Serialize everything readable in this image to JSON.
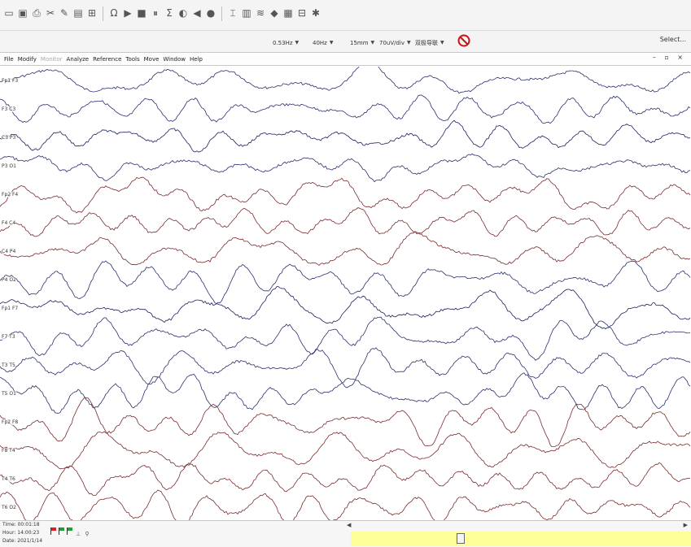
{
  "toolbar1": {
    "icons": [
      "folder-icon",
      "save-icon",
      "print-icon",
      "scissors-icon",
      "pen-icon",
      "notes-icon",
      "montage-icon",
      "ohm-icon",
      "play-icon",
      "stop-icon",
      "pause-icon",
      "sum-icon",
      "photo-icon",
      "back-icon",
      "record-icon",
      "cursor-icon",
      "histogram-icon",
      "filter-icon",
      "cube-icon",
      "map-icon",
      "grid-icon",
      "photic-icon"
    ]
  },
  "toolbar2": {
    "low_filter": "0.53Hz",
    "high_filter": "40Hz",
    "speed": "15mm",
    "sensitivity": "70uV/div",
    "montage": "双极导联",
    "select_label": "Select..."
  },
  "menu": {
    "items": [
      {
        "label": "File"
      },
      {
        "label": "Modify"
      },
      {
        "label": "Monitor",
        "disabled": true
      },
      {
        "label": "Analyze"
      },
      {
        "label": "Reference"
      },
      {
        "label": "Tools"
      },
      {
        "label": "Move"
      },
      {
        "label": "Window"
      },
      {
        "label": "Help"
      }
    ]
  },
  "channels": [
    {
      "label": "Fp1 F3",
      "color": "#2a2f6e"
    },
    {
      "label": "F3 C3",
      "color": "#2a2f6e"
    },
    {
      "label": "C3 P3",
      "color": "#1a1f5e"
    },
    {
      "label": "P3 O1",
      "color": "#2a2f6e"
    },
    {
      "label": "Fp2 F4",
      "color": "#7a2a2f"
    },
    {
      "label": "F4 C4",
      "color": "#7a2a2f"
    },
    {
      "label": "C4 P4",
      "color": "#7a2a2f"
    },
    {
      "label": "P4 O2",
      "color": "#2a2f6e"
    },
    {
      "label": "Fp1 F7",
      "color": "#1a1f5e"
    },
    {
      "label": "F7 T3",
      "color": "#2a2f6e"
    },
    {
      "label": "T3 T5",
      "color": "#2a2f6e"
    },
    {
      "label": "T5 O1",
      "color": "#2a2f6e"
    },
    {
      "label": "Fp2 F8",
      "color": "#7a2a2f"
    },
    {
      "label": "F8 T4",
      "color": "#7a2a2f"
    },
    {
      "label": "T4 T6",
      "color": "#7a2a2f"
    },
    {
      "label": "T6 O2",
      "color": "#7a2a2f"
    }
  ],
  "status": {
    "time": "Time: 00:01:18",
    "hour": "Hour: 14:00:23",
    "date": "Date: 2021/1/14"
  },
  "colors": {
    "scrollbar": "#ffff99",
    "flag_red": "#e02020",
    "flag_green": "#20a030"
  }
}
